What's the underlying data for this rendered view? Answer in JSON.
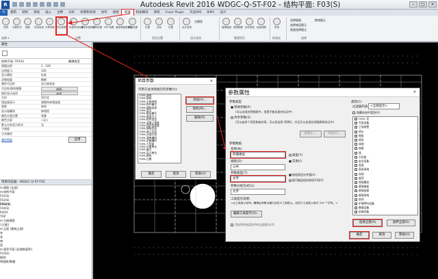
{
  "titlebar": {
    "app_title": "Autodesk Revit 2016 -",
    "doc_title": "WDGC-Q-ST-F02 - 结构平面: F03(S)"
  },
  "tabs": [
    "R",
    "建筑",
    "结构",
    "系统",
    "插入",
    "注释",
    "分析",
    "体量和场地",
    "协作",
    "视图",
    "管理",
    "附加模块",
    "修改",
    "Fuzor Plugin",
    "鸿业BIM",
    "BIM1",
    "设计"
  ],
  "ribbon": {
    "buttons": [
      "材质",
      "对象样式",
      "捕捉",
      "项目信息",
      "项目参数",
      "共享参数",
      "传递项目标准",
      "清除未使用项",
      "结构设置",
      "MEP设置",
      "面板明细表模板",
      "其他设置",
      "位置",
      "坐标",
      "位置",
      "设计选项",
      "主模型",
      "管理链接",
      "管理图像",
      "贴花类型",
      "起始视图",
      "阶段",
      "选择链接",
      "选择底层图元",
      "按面选择图元",
      "拖曳图元",
      "选择"
    ],
    "groups": [
      "设置",
      "项目位置",
      "设计选项",
      "管理项目",
      "阶段化",
      "选择"
    ],
    "select_label": "选择 ▾"
  },
  "properties": {
    "title": "属性",
    "type_name": "结构平面: F03(S)",
    "edit_type": "编辑类型",
    "rows": [
      {
        "k": "视图比例",
        "v": "1 : 100"
      },
      {
        "k": "比例值 1:",
        "v": "100"
      },
      {
        "k": "显示模型",
        "v": "标准"
      },
      {
        "k": "详细程度",
        "v": "精细"
      },
      {
        "k": "零件可见性",
        "v": "显示原状态"
      },
      {
        "k": "可见性/图形替换",
        "v": "编辑..."
      },
      {
        "k": "图形显示选项",
        "v": "编辑..."
      },
      {
        "k": "方向",
        "v": "项目北"
      },
      {
        "k": "墙连接显示",
        "v": "清理所有墙连接"
      },
      {
        "k": "规程",
        "v": "结构"
      },
      {
        "k": "显示隐藏线",
        "v": "按规程"
      },
      {
        "k": "颜色方案位置",
        "v": "背景"
      },
      {
        "k": "颜色方案",
        "v": "<无>"
      },
      {
        "k": "默认分析显示样式",
        "v": "无"
      },
      {
        "k": "子规程",
        "v": ""
      },
      {
        "k": "日光路径",
        "v": ""
      }
    ],
    "help_link": "属性帮助",
    "apply": "应用"
  },
  "browser": {
    "title": "项目浏览器 - WDGC-Q-ST-F02",
    "items": [
      "⊟ 视图 (全部)",
      "  ⊟ 结构平面",
      "      F01(S)",
      "      F02(S)",
      "      F03(S)",
      "      F04(S)",
      "      ROOF",
      "      TOP",
      "  ⊟ 三维视图",
      "      {三维}",
      "  ⊟ 立面 (建筑立面)",
      "      东",
      "      北",
      "      南",
      "      西",
      "  ⊟ 面积平面 (总建筑面积)",
      "      F03(S)",
      "  图例",
      "  明细表/数量"
    ]
  },
  "dlg1": {
    "title": "项目参数",
    "hint": "可用于此项目图元的参数(V):",
    "list": [
      "TSPR-建筑",
      "TSPR-结构",
      "TSPR-主体结构",
      "TSPR-构件编号",
      "TSPR-建筑标高",
      "TSPR-层号",
      "TSPR-楼层编号",
      "TSPR-截面尺寸",
      "TSPR-构件类型",
      "TSPR-混凝土强度",
      "TSPR-保护层厚度",
      "TSPR-钢筋信息",
      "TSPR-施工区段",
      "TSPR-分部分项",
      "TSPR-清单编码",
      "TSPR-定额编码",
      "TSPR-工程量",
      "TSPR-计量单位",
      "TSPR-备注",
      "TSPR-设计单位",
      "TSPR-审核",
      "TSPR-日期"
    ],
    "add": "添加(A)...",
    "modify": "修改(M)...",
    "delete": "删除(R)",
    "ok": "确定",
    "cancel": "取消",
    "help": "帮助(H)"
  },
  "dlg2": {
    "title": "参数属性",
    "param_type_label": "参数类型",
    "project_param": "项目参数(P)",
    "project_param_desc": "(可以出现在明细表中，但是不能出现在标记中)",
    "shared_param": "共享参数(S)",
    "shared_param_desc": "(可以由多个项目和族共享，可以导出到 ODBC，并且可以出现在明细表和标记中)",
    "select_btn": "选择(L)...",
    "export_btn": "导出(E)...",
    "param_data_label": "参数数据",
    "name_label": "名称(N):",
    "name_value": "所属楼层",
    "type_radio": "类型(Y)",
    "instance_radio": "实例(I)",
    "discipline_label": "规程(D):",
    "discipline_value": "公共",
    "ptype_label": "参数类型(T):",
    "ptype_value": "文字",
    "group_label": "参数分组方式(G):",
    "group_value": "文字",
    "by_group_type": "按组类型对齐值(A)",
    "by_group_instance": "值可能因组实例而不同(V)",
    "tooltip_label": "工具提示说明:",
    "tooltip_text": "<无工具提示说明。编辑此参数以编写自定义工具提示。自定义工具提示限为 250 个字符。>",
    "edit_tooltip": "编辑工具提示(O)...",
    "add_all_elements": "添加到所选类别中的全部图元(R)",
    "category_label": "类别(C)",
    "filter_label": "过滤器列表(F):",
    "filter_value": "<全部显示>",
    "hide_unchecked": "隐藏未选中类别(U)",
    "categories": [
      "HVAC 区",
      "专用设备",
      "卫浴装置",
      "喷头",
      "图纸",
      "地形",
      "场地",
      "坡道",
      "墙",
      "天花板",
      "安全设备",
      "家具",
      "家具系统",
      "导线",
      "屋顶",
      "常规模型",
      "幕墙嵌板",
      "幕墙竖梃",
      "幕墙系统",
      "房间",
      "护理呼叫设备",
      "数据设备",
      "机械设备"
    ],
    "select_all": "选择全部(A)",
    "deselect_all": "放弃全部(E)",
    "ok": "确定",
    "cancel": "取消",
    "help": "帮助(H)"
  },
  "colors": {
    "accent_red": "#e02020",
    "revit_blue": "#2a62b4",
    "canvas": "#000000"
  }
}
